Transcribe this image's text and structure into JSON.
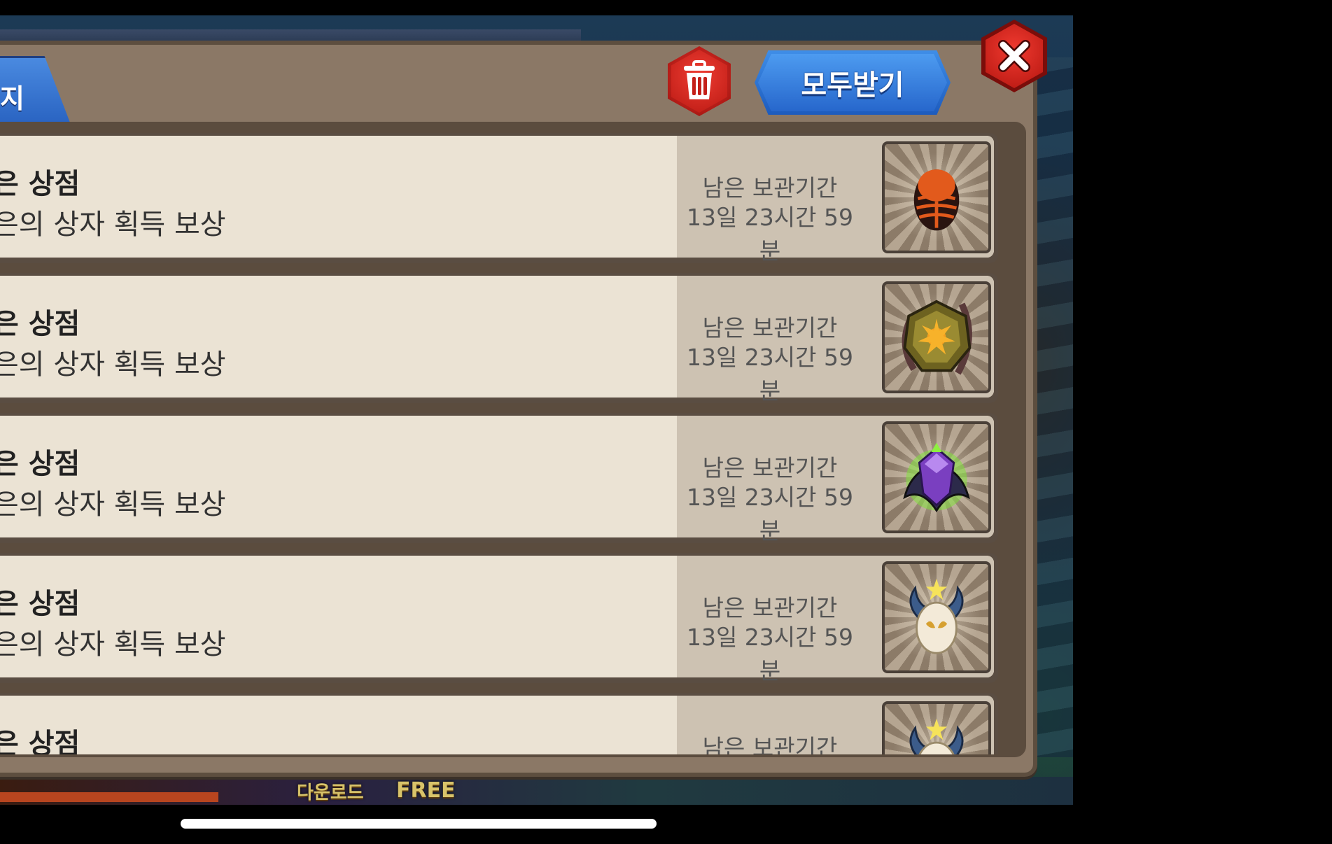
{
  "header": {
    "tab_label": "지",
    "receive_all_label": "모두받기"
  },
  "mail_items": [
    {
      "title": "은 상점",
      "desc": "은의 상자 획득 보상",
      "remain_label": "남은 보관기간",
      "remain_time": "13일 23시간 59분",
      "reward_icon": "orange-egg-icon"
    },
    {
      "title": "은 상점",
      "desc": "은의 상자 획득 보상",
      "remain_label": "남은 보관기간",
      "remain_time": "13일 23시간 59분",
      "reward_icon": "gold-sun-rune-icon"
    },
    {
      "title": "은 상점",
      "desc": "은의 상자 획득 보상",
      "remain_label": "남은 보관기간",
      "remain_time": "13일 23시간 59분",
      "reward_icon": "purple-crest-icon"
    },
    {
      "title": "은 상점",
      "desc": "은의 상자 획득 보상",
      "remain_label": "남은 보관기간",
      "remain_time": "13일 23시간 59분",
      "reward_icon": "horned-mask-icon"
    },
    {
      "title": "은 상점",
      "desc": "",
      "remain_label": "남은 보관기간",
      "remain_time": "",
      "reward_icon": "horned-mask-icon"
    }
  ],
  "background": {
    "promo_download": "다운로드",
    "promo_free": "FREE"
  },
  "colors": {
    "accent_blue": "#2a64c2",
    "danger_red": "#c42019",
    "row_bg": "#ebe3d4",
    "panel_brown": "#8b7866"
  }
}
